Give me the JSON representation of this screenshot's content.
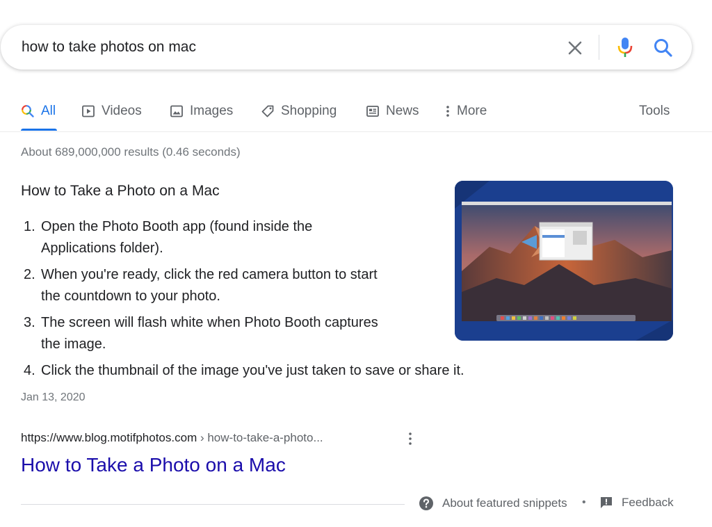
{
  "search": {
    "query": "how to take photos on mac"
  },
  "tabs": [
    {
      "label": "All",
      "icon": "search-icon"
    },
    {
      "label": "Videos",
      "icon": "play-icon"
    },
    {
      "label": "Images",
      "icon": "image-icon"
    },
    {
      "label": "Shopping",
      "icon": "tag-icon"
    },
    {
      "label": "News",
      "icon": "newspaper-icon"
    },
    {
      "label": "More",
      "icon": "vertical-dots-icon"
    }
  ],
  "tools_label": "Tools",
  "result_stats": "About 689,000,000 results (0.46 seconds)",
  "snippet": {
    "title": "How to Take a Photo on a Mac",
    "steps": [
      {
        "num": "1.",
        "text": "Open the Photo Booth app (found inside the",
        "text2": "Applications folder)."
      },
      {
        "num": "2.",
        "text": "When you're ready, click the red camera button to start",
        "text2": "the countdown to your photo."
      },
      {
        "num": "3.",
        "text": "The screen will flash white when Photo Booth captures",
        "text2": "the image."
      },
      {
        "num": "4.",
        "text": "Click the thumbnail of the image you've just taken to save or share it.",
        "text2": ""
      }
    ],
    "date": "Jan 13, 2020"
  },
  "result": {
    "url": "https://www.blog.motifphotos.com",
    "path": " › how-to-take-a-photo...",
    "title": "How to Take a Photo on a Mac"
  },
  "footer": {
    "about_label": "About featured snippets",
    "separator": "•",
    "feedback_label": "Feedback"
  },
  "colors": {
    "accent": "#1a73e8",
    "link": "#1a0dab",
    "mic_blue": "#4285f4",
    "mic_red": "#ea4335",
    "mic_yellow": "#fbbc04",
    "mic_green": "#34a853"
  }
}
